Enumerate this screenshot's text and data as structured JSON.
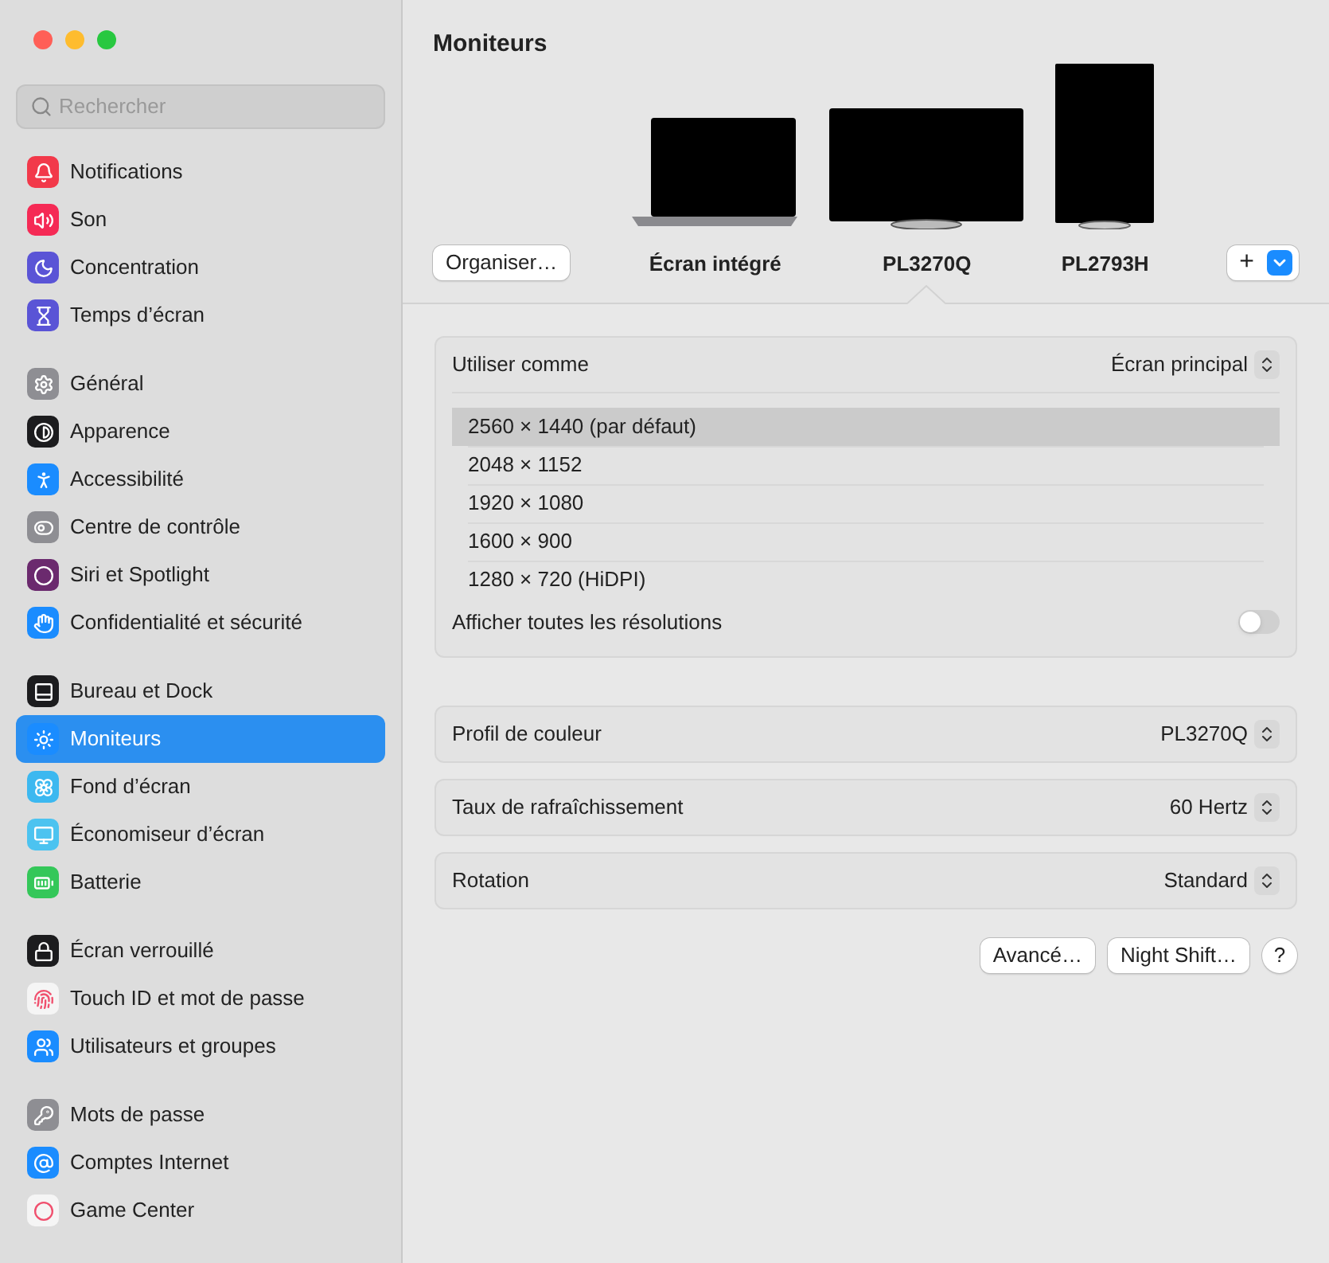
{
  "search": {
    "placeholder": "Rechercher"
  },
  "sidebar": {
    "groups": [
      [
        {
          "label": "Notifications",
          "kind": "bell",
          "color": "#f2394a",
          "selected": false
        },
        {
          "label": "Son",
          "kind": "sound",
          "color": "#f52a55",
          "selected": false
        },
        {
          "label": "Concentration",
          "kind": "moon",
          "color": "#5a54d6",
          "selected": false
        },
        {
          "label": "Temps d’écran",
          "kind": "hourglass",
          "color": "#5a54d6",
          "selected": false
        }
      ],
      [
        {
          "label": "Général",
          "kind": "gear",
          "color": "#8e8e93",
          "selected": false
        },
        {
          "label": "Apparence",
          "kind": "appearance",
          "color": "#1c1c1e",
          "selected": false
        },
        {
          "label": "Accessibilité",
          "kind": "accessibility",
          "color": "#1a8cff",
          "selected": false
        },
        {
          "label": "Centre de contrôle",
          "kind": "toggles",
          "color": "#8e8e93",
          "selected": false
        },
        {
          "label": "Siri et Spotlight",
          "kind": "siri",
          "color": "#6b2a6e",
          "selected": false
        },
        {
          "label": "Confidentialité et sécurité",
          "kind": "hand",
          "color": "#1a8cff",
          "selected": false
        }
      ],
      [
        {
          "label": "Bureau et Dock",
          "kind": "dock",
          "color": "#1c1c1e",
          "selected": false
        },
        {
          "label": "Moniteurs",
          "kind": "sun",
          "color": "#1a8cff",
          "selected": true
        },
        {
          "label": "Fond d’écran",
          "kind": "flower",
          "color": "#3cb8f0",
          "selected": false
        },
        {
          "label": "Économiseur d’écran",
          "kind": "screensaver",
          "color": "#4cc3f0",
          "selected": false
        },
        {
          "label": "Batterie",
          "kind": "battery",
          "color": "#34c759",
          "selected": false
        }
      ],
      [
        {
          "label": "Écran verrouillé",
          "kind": "lock",
          "color": "#1c1c1e",
          "selected": false
        },
        {
          "label": "Touch ID et mot de passe",
          "kind": "fingerprint",
          "color": "#f5f5f5",
          "selected": false
        },
        {
          "label": "Utilisateurs et groupes",
          "kind": "users",
          "color": "#1a8cff",
          "selected": false
        }
      ],
      [
        {
          "label": "Mots de passe",
          "kind": "key",
          "color": "#8e8e93",
          "selected": false
        },
        {
          "label": "Comptes Internet",
          "kind": "at",
          "color": "#1a8cff",
          "selected": false
        },
        {
          "label": "Game Center",
          "kind": "game",
          "color": "#f5f5f5",
          "selected": false
        }
      ]
    ]
  },
  "title": "Moniteurs",
  "arrange_button": "Organiser…",
  "displays": [
    {
      "name": "Écran intégré",
      "kind": "laptop",
      "selected": false
    },
    {
      "name": "PL3270Q",
      "kind": "monitor",
      "selected": true
    },
    {
      "name": "PL2793H",
      "kind": "portrait",
      "selected": false
    }
  ],
  "add_button": "+",
  "use_as": {
    "label": "Utiliser comme",
    "value": "Écran principal"
  },
  "resolutions": [
    {
      "label": "2560 × 1440 (par défaut)",
      "selected": true
    },
    {
      "label": "2048 × 1152",
      "selected": false
    },
    {
      "label": "1920 × 1080",
      "selected": false
    },
    {
      "label": "1600 × 900",
      "selected": false
    },
    {
      "label": "1280 × 720 (HiDPI)",
      "selected": false
    }
  ],
  "show_all": {
    "label": "Afficher toutes les résolutions",
    "on": false
  },
  "settings": [
    {
      "label": "Profil de couleur",
      "value": "PL3270Q"
    },
    {
      "label": "Taux de rafraîchissement",
      "value": "60 Hertz"
    },
    {
      "label": "Rotation",
      "value": "Standard"
    }
  ],
  "buttons": [
    "Avancé…",
    "Night Shift…",
    "?"
  ]
}
